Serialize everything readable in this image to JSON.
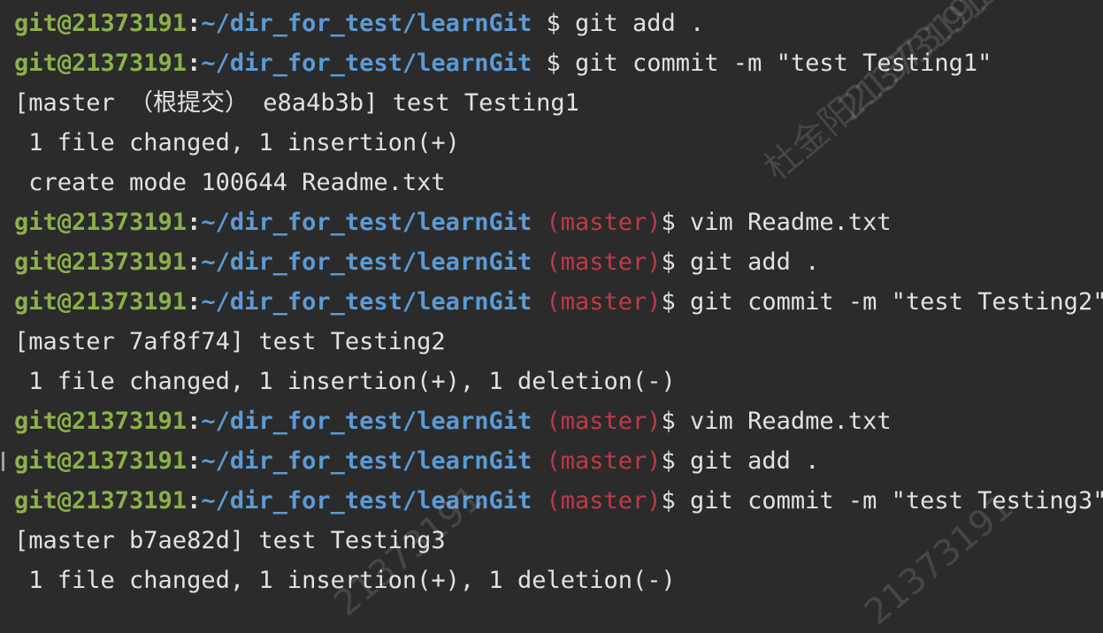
{
  "terminal": {
    "lines": [
      {
        "type": "prompt",
        "user": "git@21373191",
        "colon": ":",
        "path": "~/dir_for_test/learnGit",
        "branch": "",
        "dollar": " $ ",
        "command": "git add ."
      },
      {
        "type": "prompt",
        "user": "git@21373191",
        "colon": ":",
        "path": "~/dir_for_test/learnGit",
        "branch": "",
        "dollar": " $ ",
        "command": "git commit -m \"test Testing1\""
      },
      {
        "type": "output",
        "text": "[master （根提交） e8a4b3b] test Testing1"
      },
      {
        "type": "output",
        "text": " 1 file changed, 1 insertion(+)"
      },
      {
        "type": "output",
        "text": " create mode 100644 Readme.txt"
      },
      {
        "type": "prompt",
        "user": "git@21373191",
        "colon": ":",
        "path": "~/dir_for_test/learnGit",
        "branch": " (master)",
        "dollar": "$ ",
        "command": "vim Readme.txt"
      },
      {
        "type": "prompt",
        "user": "git@21373191",
        "colon": ":",
        "path": "~/dir_for_test/learnGit",
        "branch": " (master)",
        "dollar": "$ ",
        "command": "git add ."
      },
      {
        "type": "prompt",
        "user": "git@21373191",
        "colon": ":",
        "path": "~/dir_for_test/learnGit",
        "branch": " (master)",
        "dollar": "$ ",
        "command": "git commit -m \"test Testing2\""
      },
      {
        "type": "output",
        "text": "[master 7af8f74] test Testing2"
      },
      {
        "type": "output",
        "text": " 1 file changed, 1 insertion(+), 1 deletion(-)"
      },
      {
        "type": "prompt",
        "user": "git@21373191",
        "colon": ":",
        "path": "~/dir_for_test/learnGit",
        "branch": " (master)",
        "dollar": "$ ",
        "command": "vim Readme.txt"
      },
      {
        "type": "prompt",
        "user": "git@21373191",
        "colon": ":",
        "path": "~/dir_for_test/learnGit",
        "branch": " (master)",
        "dollar": "$ ",
        "command": "git add .",
        "marker": true
      },
      {
        "type": "prompt",
        "user": "git@21373191",
        "colon": ":",
        "path": "~/dir_for_test/learnGit",
        "branch": " (master)",
        "dollar": "$ ",
        "command": "git commit -m \"test Testing3\""
      },
      {
        "type": "output",
        "text": "[master b7ae82d] test Testing3"
      },
      {
        "type": "output",
        "text": " 1 file changed, 1 insertion(+), 1 deletion(-)"
      }
    ]
  },
  "watermarks": [
    "杜金阳21373191",
    "21373191",
    "21373191",
    "21373191"
  ],
  "colors": {
    "background": "#2b2b2b",
    "user": "#8db04b",
    "path": "#5b9bd5",
    "branch": "#c0394a",
    "text": "#e2e2e2"
  }
}
